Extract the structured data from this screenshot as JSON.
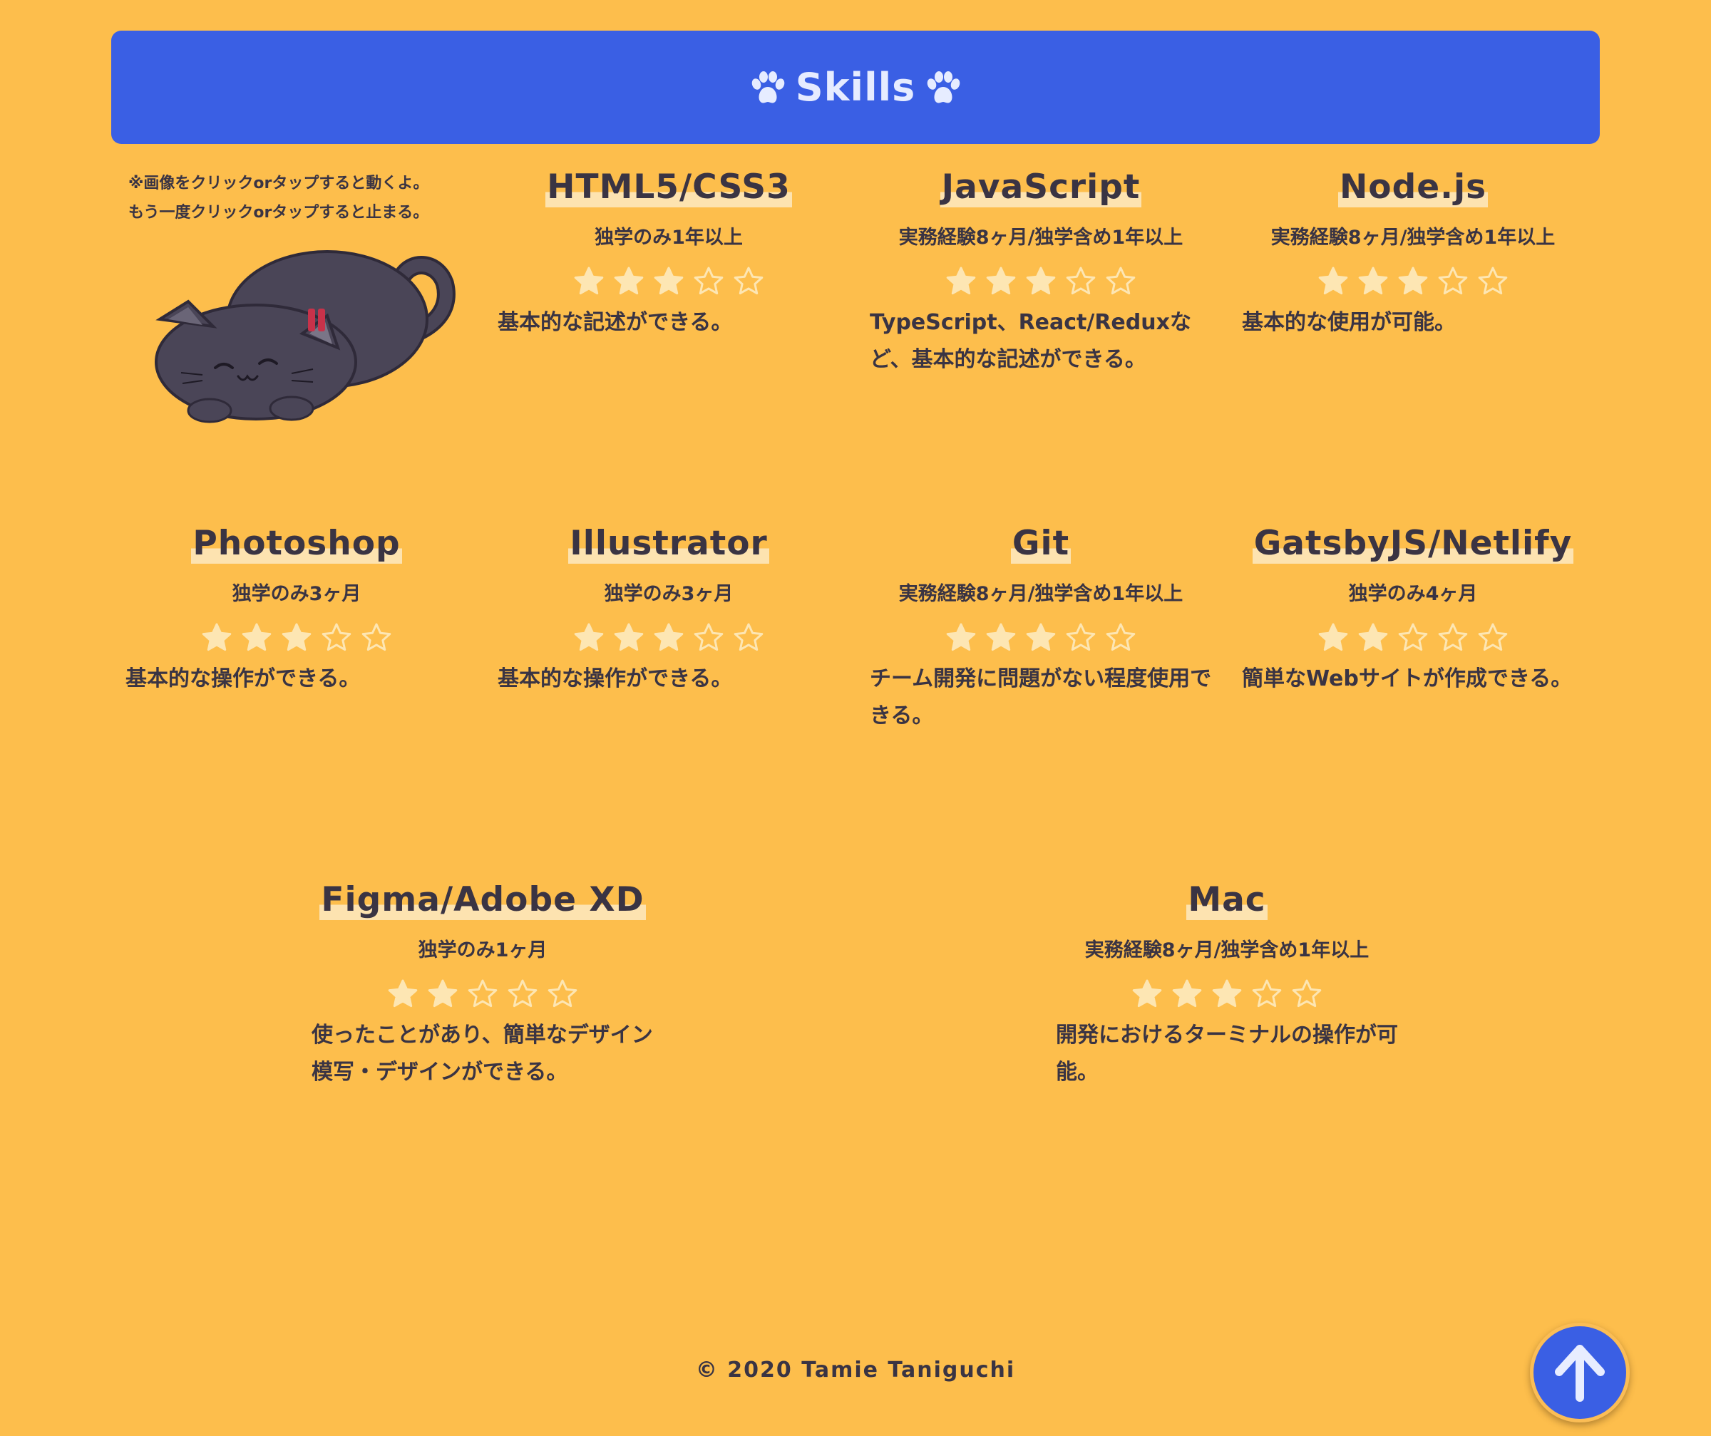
{
  "header": {
    "title": "Skills",
    "left_icon": "paw-icon",
    "right_icon": "paw-icon"
  },
  "cat": {
    "note_line1": "※画像をクリックorタップすると動くよ。",
    "note_line2": "もう一度クリックorタップすると止まる。"
  },
  "skills": [
    {
      "name": "HTML5/CSS3",
      "experience": "独学のみ1年以上",
      "rating": 3,
      "max": 5,
      "description": "基本的な記述ができる。"
    },
    {
      "name": "JavaScript",
      "experience": "実務経験8ヶ月/独学含め1年以上",
      "rating": 3,
      "max": 5,
      "description": "TypeScript、React/Reduxなど、基本的な記述ができる。"
    },
    {
      "name": "Node.js",
      "experience": "実務経験8ヶ月/独学含め1年以上",
      "rating": 3,
      "max": 5,
      "description": "基本的な使用が可能。"
    },
    {
      "name": "Photoshop",
      "experience": "独学のみ3ヶ月",
      "rating": 3,
      "max": 5,
      "description": "基本的な操作ができる。"
    },
    {
      "name": "Illustrator",
      "experience": "独学のみ3ヶ月",
      "rating": 3,
      "max": 5,
      "description": "基本的な操作ができる。"
    },
    {
      "name": "Git",
      "experience": "実務経験8ヶ月/独学含め1年以上",
      "rating": 3,
      "max": 5,
      "description": "チーム開発に問題がない程度使用できる。"
    },
    {
      "name": "GatsbyJS/Netlify",
      "experience": "独学のみ4ヶ月",
      "rating": 2,
      "max": 5,
      "description": "簡単なWebサイトが作成できる。"
    },
    {
      "name": "Figma/Adobe XD",
      "experience": "独学のみ1ヶ月",
      "rating": 2,
      "max": 5,
      "description": "使ったことがあり、簡単なデザイン模写・デザインができる。"
    },
    {
      "name": "Mac",
      "experience": "実務経験8ヶ月/独学含め1年以上",
      "rating": 3,
      "max": 5,
      "description": "開発におけるターミナルの操作が可能。"
    }
  ],
  "footer": {
    "copyright": "© 2020 Tamie Taniguchi"
  },
  "scroll_top": {
    "icon": "arrow-up-icon"
  },
  "colors": {
    "background": "#fdbe4c",
    "header": "#3a5fe4",
    "text": "#3a3443",
    "star": "#fde6b3"
  }
}
